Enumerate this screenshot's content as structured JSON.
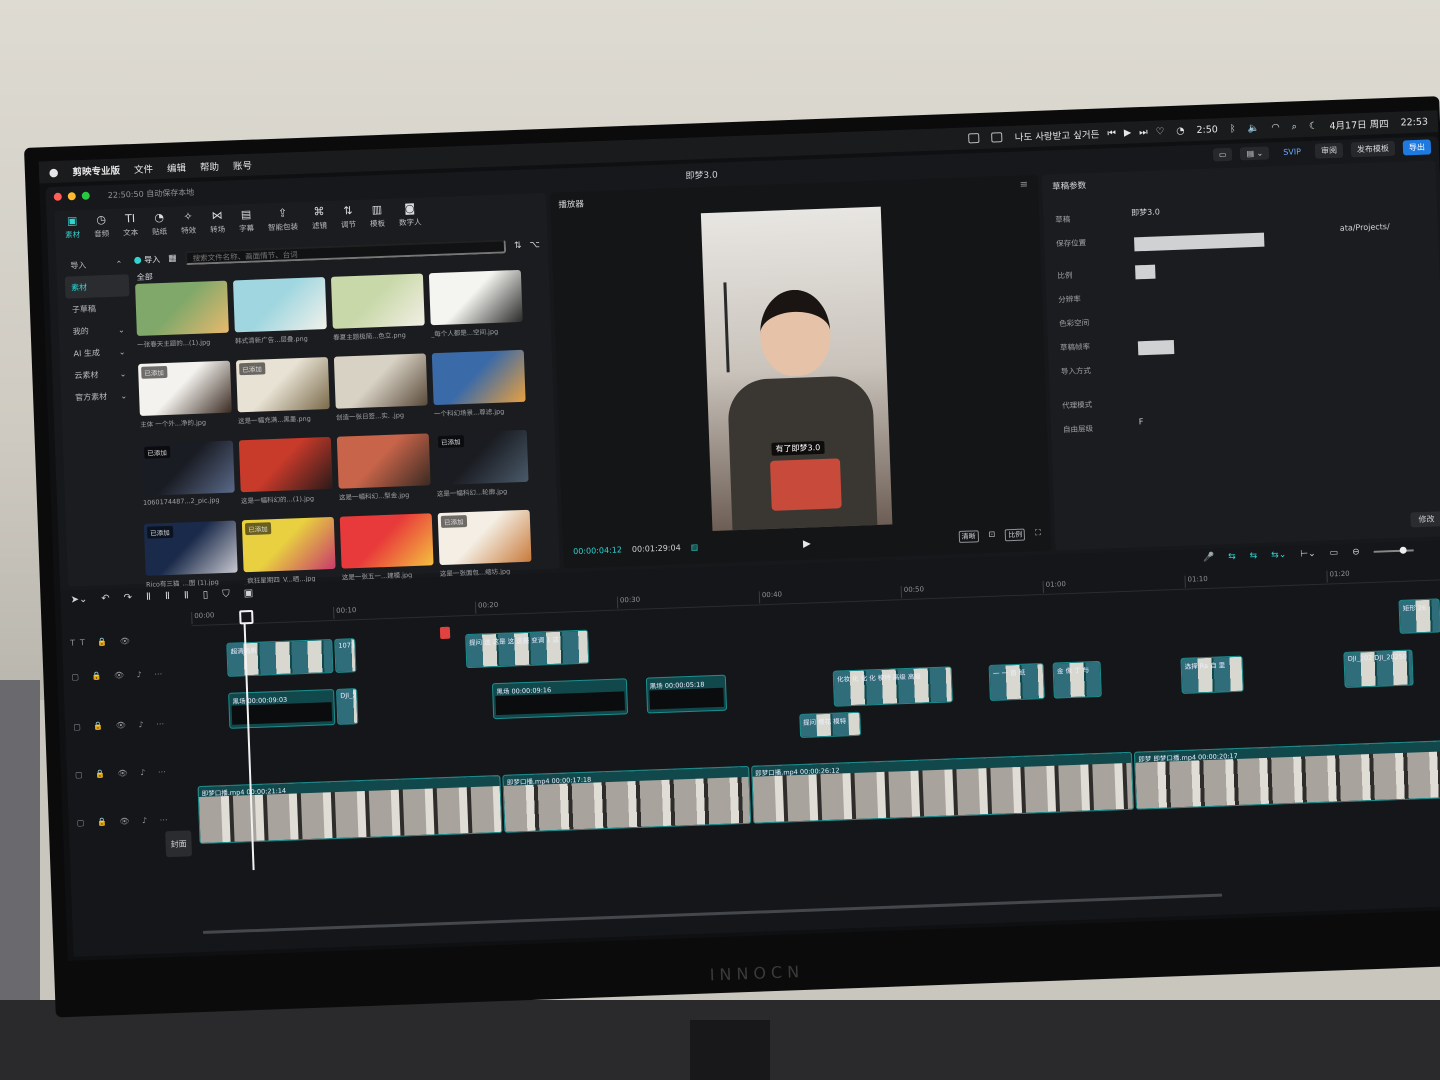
{
  "menubar": {
    "app_name": "剪映专业版",
    "menus": [
      "文件",
      "编辑",
      "帮助",
      "账号"
    ],
    "now_playing": "나도 사랑받고 싶거든",
    "timer": "2:50",
    "date": "4月17日 周四",
    "time": "22:53"
  },
  "window": {
    "autosave": "22:50:50 自动保存本地",
    "project_title": "即梦3.0",
    "vip_label": "SVIP",
    "review_label": "审阅",
    "publish_label": "发布模板",
    "export_label": "导出"
  },
  "toolbar": {
    "tools": [
      {
        "label": "素材",
        "icon": "▣"
      },
      {
        "label": "音频",
        "icon": "◷"
      },
      {
        "label": "文本",
        "icon": "TI"
      },
      {
        "label": "贴纸",
        "icon": "◔"
      },
      {
        "label": "特效",
        "icon": "✧"
      },
      {
        "label": "转场",
        "icon": "⋈"
      },
      {
        "label": "字幕",
        "icon": "▤"
      },
      {
        "label": "智能包装",
        "icon": "⇪"
      },
      {
        "label": "滤镜",
        "icon": "⌘"
      },
      {
        "label": "调节",
        "icon": "⇅"
      },
      {
        "label": "模板",
        "icon": "▥"
      },
      {
        "label": "数字人",
        "icon": "◙"
      }
    ]
  },
  "media": {
    "sidebar": [
      {
        "label": "导入",
        "chevron": "⌃"
      },
      {
        "label": "素材",
        "chevron": ""
      },
      {
        "label": "子草稿",
        "chevron": ""
      },
      {
        "label": "我的",
        "chevron": "⌄"
      },
      {
        "label": "AI 生成",
        "chevron": "⌄"
      },
      {
        "label": "云素材",
        "chevron": "⌄"
      },
      {
        "label": "官方素材",
        "chevron": "⌄"
      }
    ],
    "import_label": "导入",
    "search_placeholder": "搜索文件名称、画面情节、台词",
    "all_label": "全部",
    "added_badge": "已添加",
    "items": [
      {
        "caption": "一张春天主题的...(1).jpg",
        "added": false,
        "colors": [
          "#7fa86a",
          "#e8b96e"
        ]
      },
      {
        "caption": "韩式清新广告...层叠.png",
        "added": false,
        "colors": [
          "#9fd6e0",
          "#f1f1ea"
        ]
      },
      {
        "caption": "春夏主题极简...色立.png",
        "added": false,
        "colors": [
          "#c8d8a8",
          "#f2efe4"
        ]
      },
      {
        "caption": "_每个人都是...空间.jpg",
        "added": false,
        "colors": [
          "#f4f4f0",
          "#2a2a2a"
        ]
      },
      {
        "caption": "主体 一个外...净的.jpg",
        "added": true,
        "colors": [
          "#f4f2ee",
          "#3a2a22"
        ]
      },
      {
        "caption": "这是一幅充满...黑墨.png",
        "added": true,
        "colors": [
          "#e8e2d4",
          "#7a6a4a"
        ]
      },
      {
        "caption": "创造一张日签...实. .jpg",
        "added": false,
        "colors": [
          "#d8d2c4",
          "#5a4a3a"
        ]
      },
      {
        "caption": "一个科幻场景...尊滤.jpg",
        "added": false,
        "colors": [
          "#3a6aa8",
          "#e8a040"
        ]
      },
      {
        "caption": "1060174487...2_pic.jpg",
        "added": true,
        "colors": [
          "#1a1c24",
          "#5a6a8a"
        ]
      },
      {
        "caption": "这是一幅科幻的...(1).jpg",
        "added": false,
        "colors": [
          "#c83a2a",
          "#2a1a1a"
        ]
      },
      {
        "caption": "这是一幅科幻...型金.jpg",
        "added": false,
        "colors": [
          "#c8644a",
          "#3a2a22"
        ]
      },
      {
        "caption": "这是一幅科幻...轮廓.jpg",
        "added": true,
        "colors": [
          "#1a1c22",
          "#4a5a6a"
        ]
      },
      {
        "caption": "Rico有三猫_...图 (1).jpg",
        "added": true,
        "colors": [
          "#1a2a4a",
          "#c8c8d0"
        ]
      },
      {
        "caption": "_疯狂星期四_V...晒...jpg",
        "added": true,
        "colors": [
          "#e8d040",
          "#c83a6a"
        ]
      },
      {
        "caption": "这是一张五一...建模.jpg",
        "added": false,
        "colors": [
          "#e83a3a",
          "#f4c040"
        ]
      },
      {
        "caption": "这是一张面包...缩坊.jpg",
        "added": true,
        "colors": [
          "#f4eee4",
          "#c87a3a"
        ]
      }
    ]
  },
  "player": {
    "title": "播放器",
    "subtitle_text": "有了即梦3.0",
    "current_time": "00:00:04:12",
    "duration": "00:01:29:04",
    "quality_label": "清晰",
    "ratio_label": "比例"
  },
  "properties": {
    "title": "草稿参数",
    "rows": [
      {
        "label": "草稿",
        "value": "即梦3.0"
      },
      {
        "label": "保存位置",
        "value": "ata/Projects/"
      },
      {
        "label": "比例",
        "value": ""
      },
      {
        "label": "分辨率",
        "value": ""
      },
      {
        "label": "色彩空间",
        "value": ""
      },
      {
        "label": "草稿帧率",
        "value": ""
      },
      {
        "label": "导入方式",
        "value": ""
      },
      {
        "label": "代理模式",
        "value": ""
      },
      {
        "label": "自由层级",
        "value": "F"
      }
    ],
    "modify_label": "修改"
  },
  "timeline": {
    "ruler": [
      "00:00",
      "00:10",
      "00:20",
      "00:30",
      "00:40",
      "00:50",
      "01:00",
      "01:10",
      "01:20"
    ],
    "cover_label": "封面",
    "clips": [
      {
        "label": "黑场  00:00:09:03",
        "type": "dark",
        "track": 2,
        "start": 2.4,
        "end": 10.0
      },
      {
        "label": "DJI_2",
        "type": "img",
        "track": 2,
        "start": 10.0,
        "end": 11.6
      },
      {
        "label": "黑场  00:00:09:16",
        "type": "dark",
        "track": 2,
        "start": 21.0,
        "end": 30.6
      },
      {
        "label": "黑场  00:00:05:18",
        "type": "dark",
        "track": 2,
        "start": 31.8,
        "end": 37.6
      },
      {
        "label": "超清画质",
        "type": "img",
        "track": 1,
        "start": 2.4,
        "end": 10.0
      },
      {
        "label": "10737",
        "type": "img",
        "track": 1,
        "start": 10.0,
        "end": 11.6
      },
      {
        "label": "提问 这 这是 这 这是  变调 1 这",
        "type": "img",
        "track": 1,
        "start": 19.2,
        "end": 28.0
      },
      {
        "label": "化妆 化 化 化 模特 高级 高级",
        "type": "img",
        "track": 2,
        "start": 45.0,
        "end": 53.5
      },
      {
        "label": "一 一 首 纸",
        "type": "img",
        "track": 2,
        "start": 56.0,
        "end": 60.0
      },
      {
        "label": "金 像 丁 与",
        "type": "img",
        "track": 2,
        "start": 60.5,
        "end": 64.0
      },
      {
        "label": "选择 Ra 自 里",
        "type": "img",
        "track": 2,
        "start": 69.5,
        "end": 74.0
      },
      {
        "label": "DJI_202  DJI_20250",
        "type": "img",
        "track": 2,
        "start": 81.0,
        "end": 86.0
      },
      {
        "label": "矩形 26",
        "type": "img",
        "track": 1,
        "start": 85.0,
        "end": 88.0
      },
      {
        "label": "提问 樱花 模特",
        "type": "img",
        "track": 3,
        "start": 42.5,
        "end": 47.0
      },
      {
        "label": "即梦口播.mp4  00:00:21:14",
        "type": "main",
        "track": 4,
        "start": 0.0,
        "end": 21.5
      },
      {
        "label": "即梦口播.mp4  00:00:17:18",
        "type": "main",
        "track": 4,
        "start": 21.5,
        "end": 39.0
      },
      {
        "label": "即梦口播.mp4  00:00:26:12",
        "type": "main",
        "track": 4,
        "start": 39.0,
        "end": 66.0
      },
      {
        "label": "即梦  即梦口播.mp4  00:00:20:17",
        "type": "main",
        "track": 4,
        "start": 66.0,
        "end": 89.0
      }
    ]
  },
  "dock": {
    "apps": [
      {
        "name": "finder-icon",
        "glyph": "☻",
        "color": "#2a7ee8"
      },
      {
        "name": "launchpad-icon",
        "glyph": "⠿",
        "color": "#e85a9a"
      },
      {
        "name": "chrome-icon",
        "glyph": "◉",
        "color": "#e8453a"
      },
      {
        "name": "notes-icon",
        "glyph": "≡",
        "color": "#f4d040"
      },
      {
        "name": "settings-icon",
        "glyph": "⚙",
        "color": "#8a8a8e"
      },
      {
        "name": "power-icon",
        "glyph": "⏻",
        "color": "#8a2ae8"
      },
      {
        "name": "wechat-icon",
        "glyph": "✆",
        "color": "#2ac84a"
      },
      {
        "name": "netease-music-icon",
        "glyph": "♫",
        "color": "#e8303a"
      },
      {
        "name": "feishu-icon",
        "glyph": "✈",
        "color": "#3ac8c8"
      },
      {
        "name": "capcut-icon",
        "glyph": "✂",
        "color": "#111"
      },
      {
        "name": "preview-icon",
        "glyph": "▭",
        "color": "#4a7ab8"
      },
      {
        "name": "app-orange-icon",
        "glyph": "◆",
        "color": "#f49a2a"
      },
      {
        "name": "app-arrow-icon",
        "glyph": "▲",
        "color": "#2a6ae8"
      },
      {
        "name": "camera-icon",
        "glyph": "■",
        "color": "#222"
      },
      {
        "name": "trash-icon",
        "glyph": "▯",
        "color": "#9a9aa0"
      }
    ]
  }
}
